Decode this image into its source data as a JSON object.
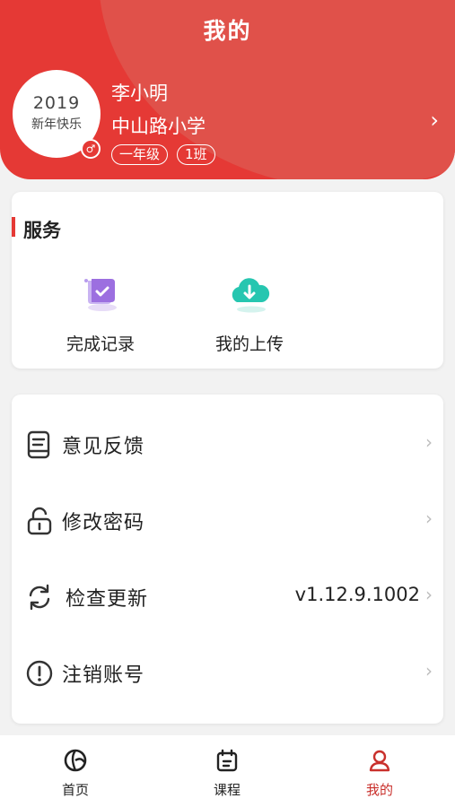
{
  "header": {
    "title": "我的",
    "avatar_year": "2019",
    "avatar_text": "新年快乐",
    "gender_symbol": "♂",
    "user_name": "李小明",
    "school": "中山路小学",
    "grade_tag": "一年级",
    "class_tag": "1班",
    "chevron": "›"
  },
  "services": {
    "title": "服务",
    "items": [
      {
        "label": "完成记录",
        "icon": "scroll-check-icon"
      },
      {
        "label": "我的上传",
        "icon": "cloud-download-icon"
      }
    ]
  },
  "settings": {
    "items": [
      {
        "label": "意见反馈",
        "icon": "feedback-icon",
        "value": ""
      },
      {
        "label": "修改密码",
        "icon": "lock-icon",
        "value": ""
      },
      {
        "label": "检查更新",
        "icon": "refresh-icon",
        "value": "v1.12.9.1002"
      },
      {
        "label": "注销账号",
        "icon": "warning-icon",
        "value": ""
      }
    ],
    "chevron": "›"
  },
  "tabbar": {
    "items": [
      {
        "label": "首页",
        "icon": "home-icon",
        "active": false
      },
      {
        "label": "课程",
        "icon": "calendar-icon",
        "active": false
      },
      {
        "label": "我的",
        "icon": "user-icon",
        "active": true
      }
    ]
  },
  "colors": {
    "brand": "#e53935",
    "active_tab": "#c9302c",
    "upload_icon": "#26c6b0",
    "record_icon": "#9c6fe0"
  }
}
